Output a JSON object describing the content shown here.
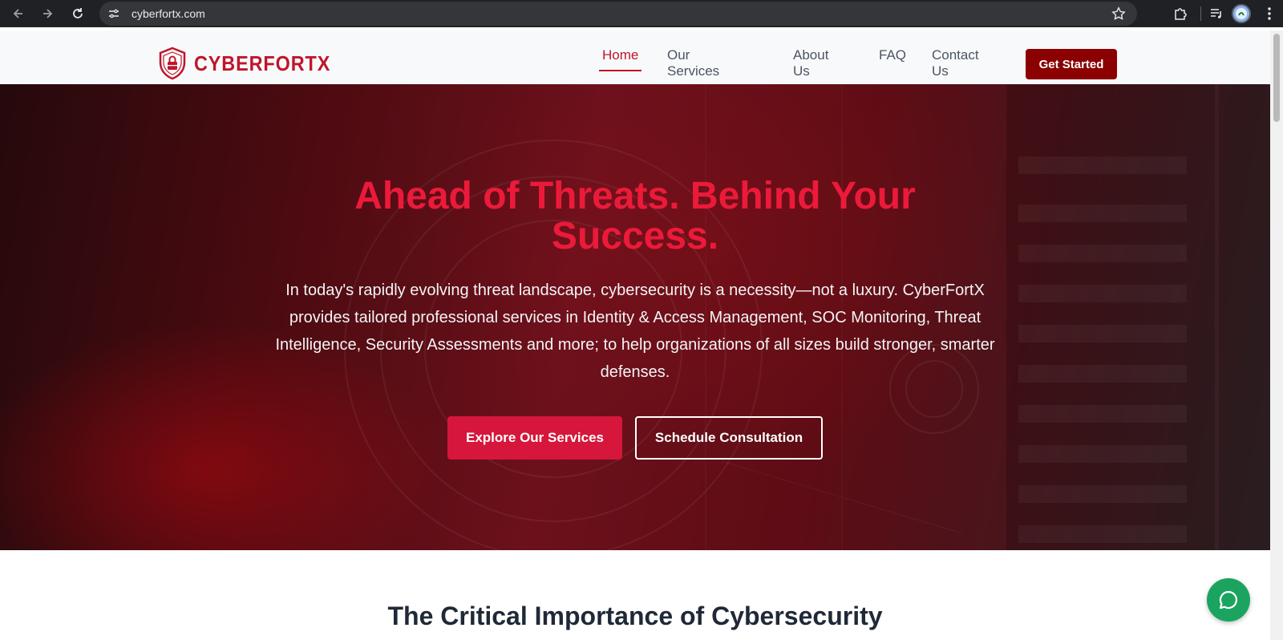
{
  "browser": {
    "url": "cyberfortx.com",
    "back_icon": "arrow-left-icon",
    "forward_icon": "arrow-right-icon",
    "reload_icon": "reload-icon",
    "site_info_icon": "tune-icon",
    "bookmark_icon": "star-icon",
    "extensions_icon": "puzzle-icon",
    "media_icon": "playlist-icon",
    "menu_icon": "kebab-menu-icon"
  },
  "navbar": {
    "logo_text": "CYBERFORTX",
    "links": [
      {
        "label": "Home",
        "active": true
      },
      {
        "label": "Our Services",
        "has_dropdown": true
      },
      {
        "label": "About Us"
      },
      {
        "label": "FAQ"
      },
      {
        "label": "Contact Us"
      }
    ],
    "cta_label": "Get Started"
  },
  "hero": {
    "title_line1": "Ahead of Threats. Behind Your",
    "title_line2": "Success.",
    "subtitle": "In today's rapidly evolving threat landscape, cybersecurity is a necessity—not a luxury. CyberFortX provides tailored professional services in Identity & Access Management, SOC Monitoring, Threat Intelligence, Security Assessments and more; to help organizations of all sizes build stronger, smarter defenses.",
    "primary_button": "Explore Our Services",
    "secondary_button": "Schedule Consultation"
  },
  "section": {
    "title": "The Critical Importance of Cybersecurity"
  },
  "chat_widget": {
    "icon": "chat-bubble-icon"
  },
  "colors": {
    "brand_red": "#c0152a",
    "cta_dark_red": "#8b0000",
    "hero_title": "#ec1a3a",
    "primary_button": "#d6163b",
    "chat_green": "#1aa45f"
  }
}
